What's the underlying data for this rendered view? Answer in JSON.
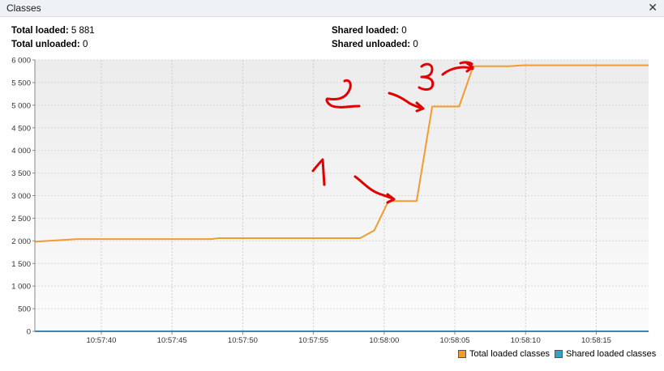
{
  "window": {
    "title": "Classes"
  },
  "stats": {
    "total_loaded_label": "Total loaded:",
    "total_loaded_value": "5 881",
    "total_unloaded_label": "Total unloaded:",
    "total_unloaded_value": "0",
    "shared_loaded_label": "Shared loaded:",
    "shared_loaded_value": "0",
    "shared_unloaded_label": "Shared unloaded:",
    "shared_unloaded_value": "0"
  },
  "legend": {
    "total": "Total loaded classes",
    "shared": "Shared loaded classes"
  },
  "colors": {
    "total": "#f29b30",
    "shared": "#2fa3c9",
    "annotation": "#e00000"
  },
  "annotations": [
    "1",
    "2",
    "3"
  ],
  "chart_data": {
    "type": "line",
    "x_tick_labels": [
      "10:57:40",
      "10:57:45",
      "10:57:50",
      "10:57:55",
      "10:58:00",
      "10:58:05",
      "10:58:10",
      "10:58:15"
    ],
    "x_tick_seconds": [
      40,
      45,
      50,
      55,
      60,
      65,
      70,
      75
    ],
    "xlim": [
      35.3,
      78.7
    ],
    "ylim": [
      0,
      6000
    ],
    "y_ticks": [
      0,
      500,
      1000,
      1500,
      2000,
      2500,
      3000,
      3500,
      4000,
      4500,
      5000,
      5500,
      6000
    ],
    "y_tick_labels": [
      "0",
      "500",
      "1 000",
      "1 500",
      "2 000",
      "2 500",
      "3 000",
      "3 500",
      "4 000",
      "4 500",
      "5 000",
      "5 500",
      "6 000"
    ],
    "series": [
      {
        "name": "Total loaded classes",
        "x": [
          35.3,
          38.3,
          47.8,
          48.3,
          58.3,
          59.3,
          60.3,
          62.3,
          63.4,
          65.3,
          66.3,
          68.8,
          69.8,
          78.7
        ],
        "y": [
          1980,
          2040,
          2040,
          2060,
          2060,
          2230,
          2880,
          2880,
          4970,
          4970,
          5860,
          5860,
          5881,
          5881
        ]
      },
      {
        "name": "Shared loaded classes",
        "x": [
          35.3,
          78.7
        ],
        "y": [
          0,
          0
        ]
      }
    ],
    "grid": true
  }
}
